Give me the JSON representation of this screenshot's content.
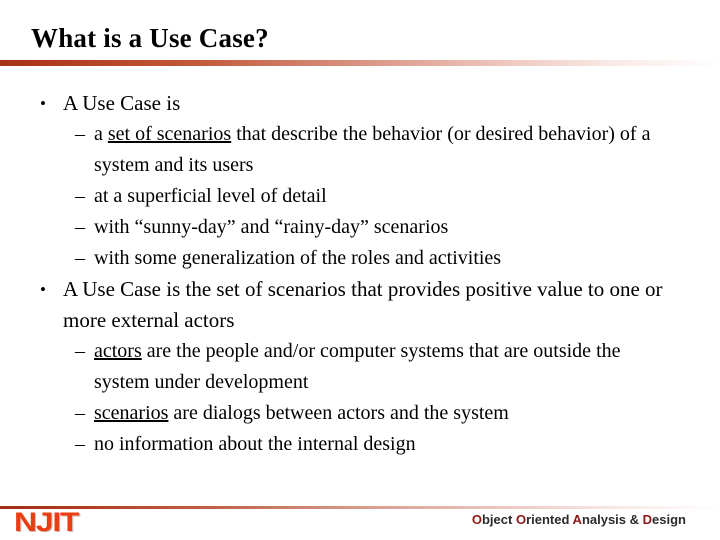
{
  "slide": {
    "title": "What is a Use Case?",
    "background_color": "#ffffff",
    "accent_color": "#a63217",
    "title_color": "#000000"
  },
  "content": {
    "bullets": [
      {
        "level": 1,
        "marker": "•",
        "text": "A Use Case is"
      },
      {
        "level": 2,
        "marker": "–",
        "text_before": "a ",
        "underlined": "set of scenarios",
        "text_after": " that describe the behavior (or desired behavior) of a system and its users"
      },
      {
        "level": 2,
        "marker": "–",
        "text": "at a superficial level of detail"
      },
      {
        "level": 2,
        "marker": "–",
        "text": "with “sunny-day” and “rainy-day” scenarios"
      },
      {
        "level": 2,
        "marker": "–",
        "text": "with some generalization of the roles and activities"
      },
      {
        "level": 1,
        "marker": "•",
        "text": "A Use Case is the set of scenarios that provides positive value to one or more external actors"
      },
      {
        "level": 2,
        "marker": "–",
        "text_before": "",
        "underlined": "actors",
        "text_after": " are the people and/or computer systems that are outside the system under development"
      },
      {
        "level": 2,
        "marker": "–",
        "text_before": "",
        "underlined": "scenarios",
        "text_after": " are dialogs between actors and the system"
      },
      {
        "level": 2,
        "marker": "–",
        "text": "no information about the internal design"
      }
    ]
  },
  "footer": {
    "logo_text": "NJIT",
    "logo_color": "#ec3c12",
    "course": {
      "full": "Object Oriented Analysis & Design",
      "segments": [
        {
          "text": "O",
          "highlight": true
        },
        {
          "text": "bject ",
          "highlight": false
        },
        {
          "text": "O",
          "highlight": true
        },
        {
          "text": "riented ",
          "highlight": false
        },
        {
          "text": "A",
          "highlight": true
        },
        {
          "text": "nalysis & ",
          "highlight": false
        },
        {
          "text": "D",
          "highlight": true
        },
        {
          "text": "esign",
          "highlight": false
        }
      ],
      "highlight_color": "#8e1616",
      "base_color": "#2b2b2b"
    }
  }
}
